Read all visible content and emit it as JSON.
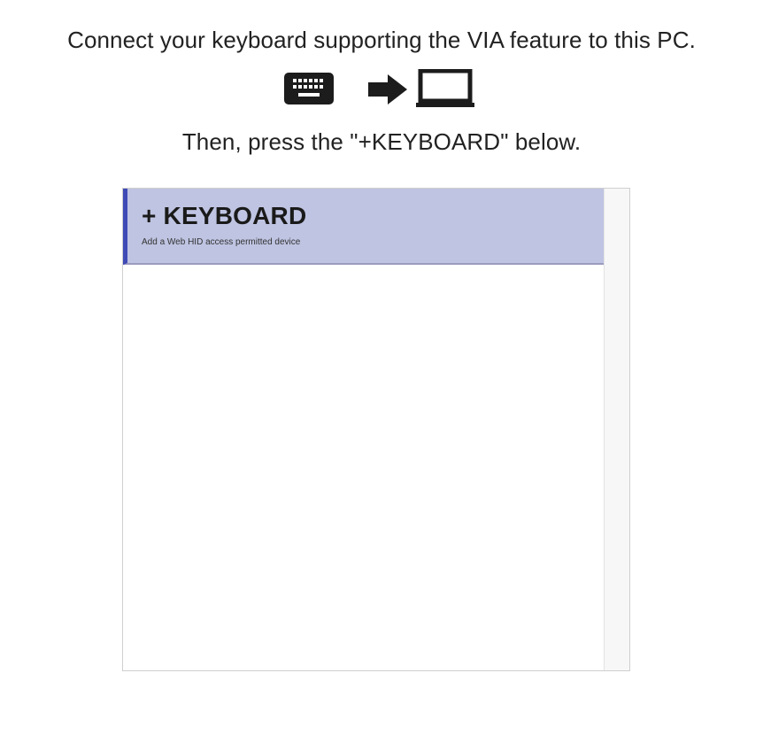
{
  "instructions": {
    "connect_text": "Connect your keyboard supporting the VIA feature to this PC.",
    "press_text": "Then, press the \"+KEYBOARD\" below."
  },
  "icons": {
    "keyboard": "keyboard-icon",
    "arrow": "arrow-right-icon",
    "laptop": "laptop-icon"
  },
  "device_list": {
    "add_item": {
      "title": "+ KEYBOARD",
      "description": "Add a Web HID access permitted device"
    }
  },
  "colors": {
    "selected_item_bg": "#bfc4e2",
    "selected_item_accent": "#3f4ab5",
    "icon_color": "#1c1c1c"
  }
}
